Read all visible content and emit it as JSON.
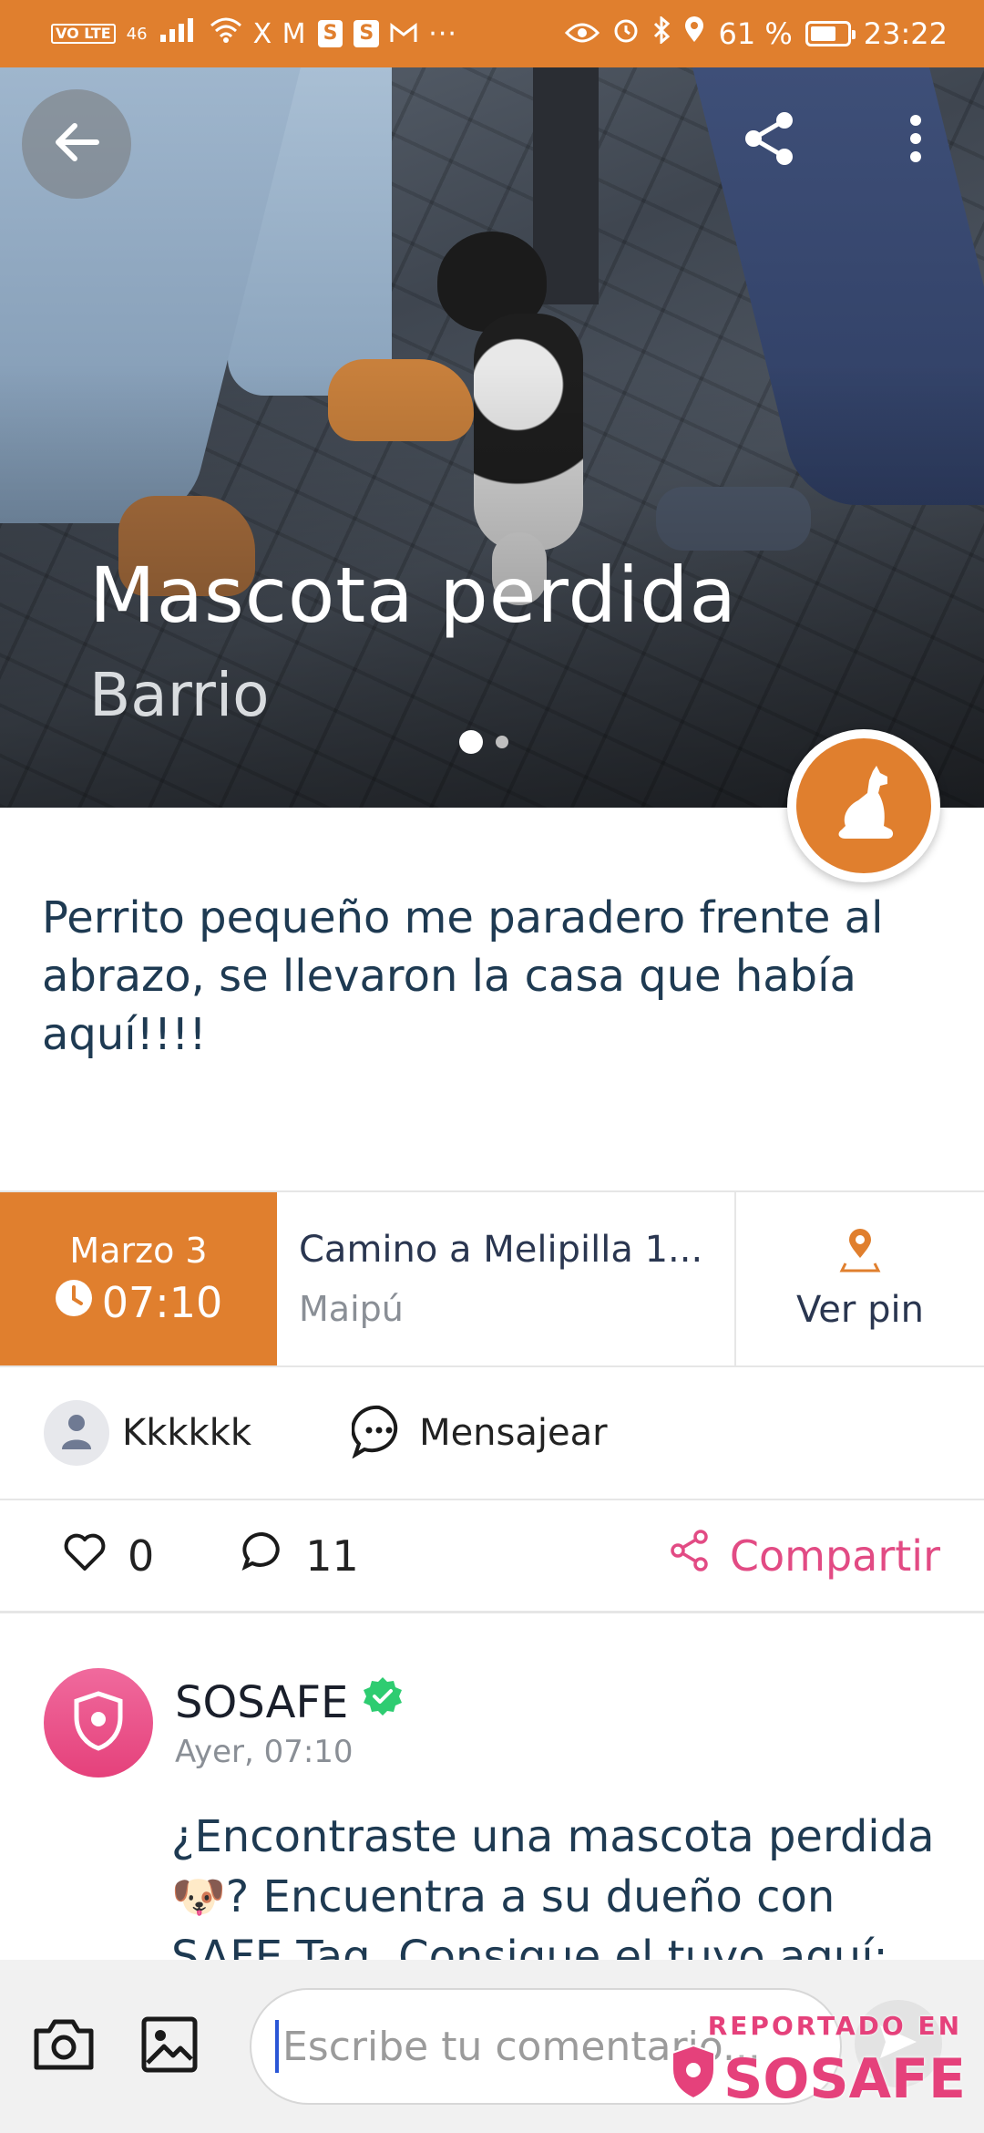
{
  "status_bar": {
    "network_badge": "VO LTE",
    "signal_label": "46",
    "app_badges": [
      "S",
      "S"
    ],
    "notif_letters": "X M",
    "more": "···",
    "battery": "61 %",
    "battery_level": 0.61,
    "time": "23:22"
  },
  "post": {
    "category": "Mascota perdida",
    "scope": "Barrio",
    "image_count": 2,
    "current_image": 1,
    "description": "Perrito pequeño me paradero frente al abrazo, se llevaron la casa que había aquí!!!!",
    "date": "Marzo 3",
    "time": "07:10",
    "address": "Camino a Melipilla  1...",
    "commune": "Maipú",
    "pin_label": "Ver pin"
  },
  "author": {
    "name": "Kkkkkk",
    "message_label": "Mensajear"
  },
  "actions": {
    "likes": "0",
    "comments": "11",
    "share_label": "Compartir"
  },
  "comment": {
    "author": "SOSAFE",
    "verified": true,
    "time": "Ayer, 07:10",
    "text": "¿Encontraste una mascota perdida 🐶? Encuentra a su dueño con SAFE Tag. Consigue el tuyo aquí:"
  },
  "composer": {
    "placeholder": "Escribe tu comentario..."
  },
  "watermark": {
    "top": "REPORTADO EN",
    "brand": "SOSAFE"
  },
  "colors": {
    "accent": "#e07f2e",
    "brand_pink": "#e5417b",
    "verified": "#2ecc71",
    "text_dark": "#1e3a52"
  },
  "icons": [
    "back-arrow-icon",
    "share-icon",
    "more-vertical-icon",
    "dog-icon",
    "clock-icon",
    "map-pin-icon",
    "user-icon",
    "chat-bubble-icon",
    "heart-icon",
    "comment-icon",
    "share-nodes-icon",
    "shield-icon",
    "verified-badge-icon",
    "camera-icon",
    "image-icon",
    "send-icon"
  ]
}
